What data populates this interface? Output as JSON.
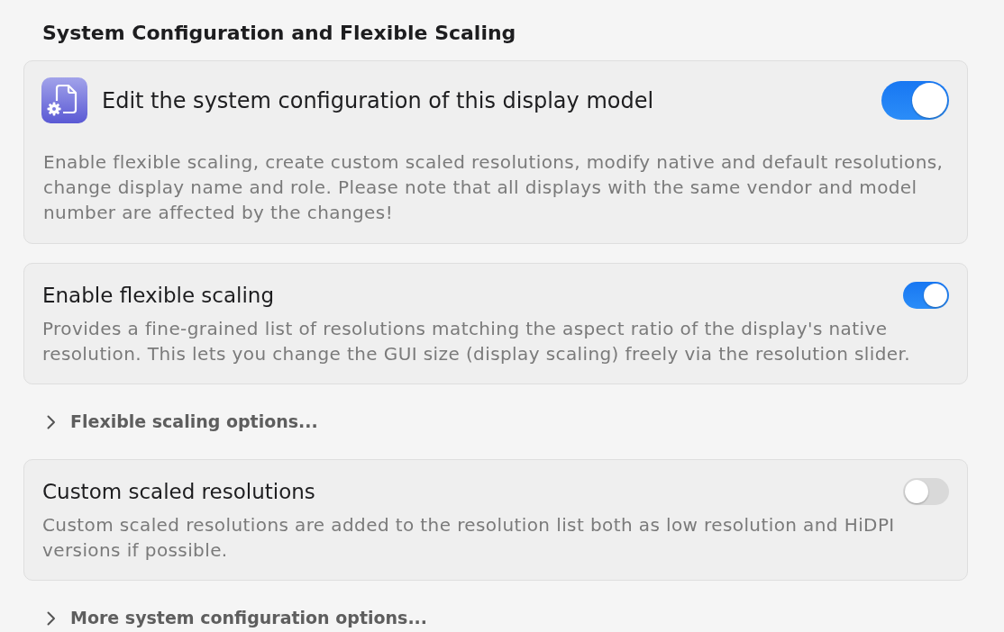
{
  "heading": "System Configuration and Flexible Scaling",
  "items": [
    {
      "kind": "main_card",
      "title": "Edit the system configuration of this display model",
      "description": "Enable flexible scaling, create custom scaled resolutions, modify native and default resolutions, change display name and role. Please note that all displays with the same vendor and model number are affected by the changes!",
      "on": true
    },
    {
      "kind": "card",
      "title": "Enable flexible scaling",
      "description": "Provides a fine-grained list of resolutions matching the aspect ratio of the display's native resolution. This lets you change the GUI size (display scaling) freely via the resolution slider.",
      "on": true
    },
    {
      "kind": "disclosure",
      "label": "Flexible scaling options...",
      "expanded": false
    },
    {
      "kind": "card",
      "title": "Custom scaled resolutions",
      "description": "Custom scaled resolutions are added to the resolution list both as low resolution and HiDPI versions if possible.",
      "on": false
    },
    {
      "kind": "disclosure",
      "label": "More system configuration options...",
      "expanded": false
    }
  ]
}
